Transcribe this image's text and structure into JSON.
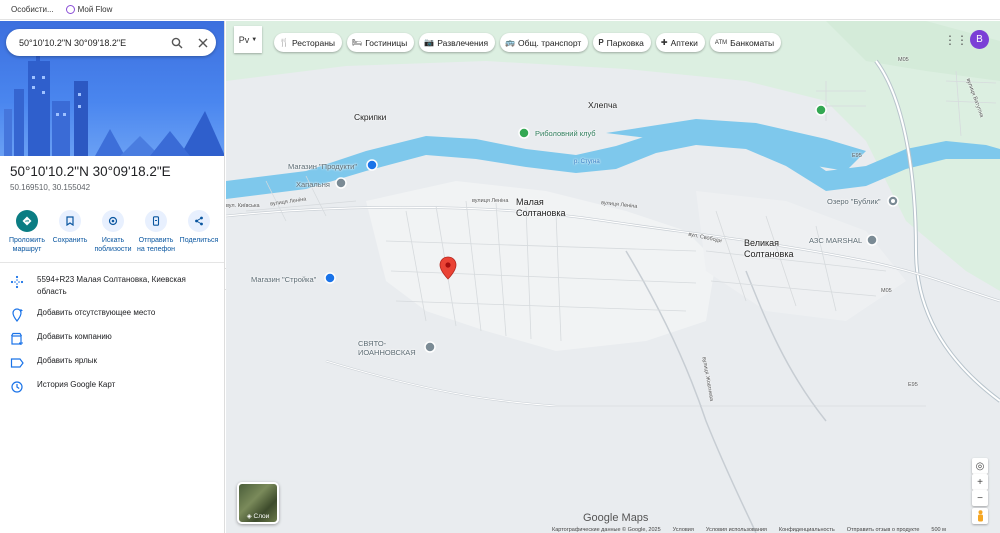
{
  "bookmarks": [
    {
      "label": "Особисти...",
      "icon": "bookmark-icon"
    },
    {
      "label": "Мой Flow",
      "icon": "flow-icon"
    }
  ],
  "search": {
    "value": "50°10'10.2\"N 30°09'18.2\"E",
    "search_icon": "search-icon",
    "close_icon": "close-icon"
  },
  "place": {
    "title": "50°10'10.2\"N 30°09'18.2\"E",
    "coords": "50.169510, 30.155042"
  },
  "actions": [
    {
      "label": "Проложить маршрут",
      "icon": "directions-icon"
    },
    {
      "label": "Сохранить",
      "icon": "bookmark-icon"
    },
    {
      "label": "Искать поблизости",
      "icon": "nearby-icon"
    },
    {
      "label": "Отправить на телефон",
      "icon": "phone-icon"
    },
    {
      "label": "Поделиться",
      "icon": "share-icon"
    }
  ],
  "info": [
    {
      "text": "5594+R23 Малая Солтановка, Киевская область",
      "icon": "plus-code-icon"
    },
    {
      "text": "Добавить отсутствующее место",
      "icon": "add-place-icon"
    },
    {
      "text": "Добавить компанию",
      "icon": "add-business-icon"
    },
    {
      "text": "Добавить ярлык",
      "icon": "label-icon"
    },
    {
      "text": "История Google Карт",
      "icon": "history-icon"
    }
  ],
  "map": {
    "lang_label": "Pv",
    "chips": [
      {
        "label": "Рестораны",
        "icon": "restaurant-icon"
      },
      {
        "label": "Гостиницы",
        "icon": "hotel-icon"
      },
      {
        "label": "Развлечения",
        "icon": "camera-icon"
      },
      {
        "label": "Общ. транспорт",
        "icon": "transit-icon"
      },
      {
        "label": "Парковка",
        "icon": "parking-icon"
      },
      {
        "label": "Аптеки",
        "icon": "pharmacy-icon"
      },
      {
        "label": "Банкоматы",
        "icon": "atm-icon"
      }
    ],
    "avatar": "B",
    "layers_label": "Слои",
    "logo": "Google Maps",
    "labels": {
      "skripki": "Скрипки",
      "hlepcha": "Хлепча",
      "malaya": "Малая\nСолтановка",
      "velikaya": "Великая\nСолтановка",
      "magazin_produkty": "Магазин \"Продукти\"",
      "hapalnya": "Хапальня",
      "ribolovny": "Риболовний клуб",
      "ozero": "Озеро \"Бублик\"",
      "azs": "АЗС MARSHAL",
      "stroyka": "Магазин \"Стройка\"",
      "svyato": "СВЯТО-\nИОАННОВСКАЯ",
      "river": "р. Стугна",
      "lenina1": "вулиця Леніна",
      "lenina2": "вулиця Леніна",
      "lenina3": "вулиця Леніна",
      "kievska": "вул. Київська",
      "svobody": "вул. Свободи",
      "m05a": "M05",
      "m05b": "M05",
      "e95a": "E95",
      "e95b": "E95",
      "zhovtneva": "вулиця Жовтнева",
      "vatutina": "вулиця Ватутіна"
    },
    "footer": [
      "Картографические данные © Google, 2025",
      "Условия",
      "Условия использования",
      "Конфиденциальность",
      "Отправить отзыв о продукте",
      "500 м"
    ]
  }
}
